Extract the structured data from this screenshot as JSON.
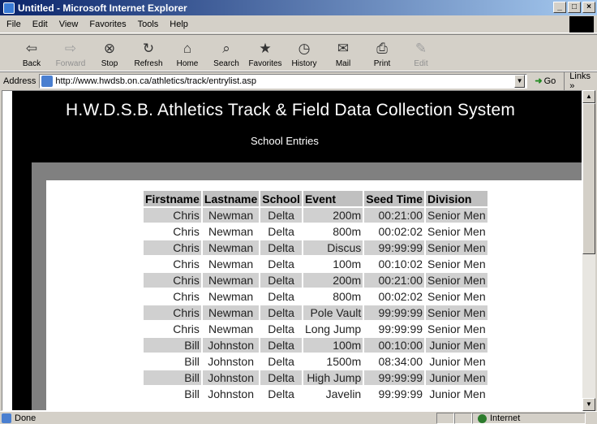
{
  "window": {
    "title": "Untitled - Microsoft Internet Explorer",
    "buttons": [
      "_",
      "□",
      "×"
    ]
  },
  "menu": [
    "File",
    "Edit",
    "View",
    "Favorites",
    "Tools",
    "Help"
  ],
  "toolbar": [
    {
      "label": "Back",
      "icon": "⇦",
      "disabled": false
    },
    {
      "label": "Forward",
      "icon": "⇨",
      "disabled": true
    },
    {
      "label": "Stop",
      "icon": "⊗",
      "disabled": false
    },
    {
      "label": "Refresh",
      "icon": "↻",
      "disabled": false
    },
    {
      "label": "Home",
      "icon": "⌂",
      "disabled": false
    },
    {
      "label": "Search",
      "icon": "⌕",
      "disabled": false
    },
    {
      "label": "Favorites",
      "icon": "★",
      "disabled": false
    },
    {
      "label": "History",
      "icon": "◷",
      "disabled": false
    },
    {
      "label": "Mail",
      "icon": "✉",
      "disabled": false
    },
    {
      "label": "Print",
      "icon": "⎙",
      "disabled": false
    },
    {
      "label": "Edit",
      "icon": "✎",
      "disabled": true
    }
  ],
  "address": {
    "label": "Address",
    "url": "http://www.hwdsb.on.ca/athletics/track/entrylist.asp",
    "go_label": "Go",
    "links_label": "Links »"
  },
  "page": {
    "title": "H.W.D.S.B. Athletics Track & Field Data Collection System",
    "subtitle": "School Entries"
  },
  "table": {
    "headers": [
      "Firstname",
      "Lastname",
      "School",
      "Event",
      "Seed Time",
      "Division"
    ],
    "rows": [
      [
        "Chris",
        "Newman",
        "Delta",
        "200m",
        "00:21:00",
        "Senior Men"
      ],
      [
        "Chris",
        "Newman",
        "Delta",
        "800m",
        "00:02:02",
        "Senior Men"
      ],
      [
        "Chris",
        "Newman",
        "Delta",
        "Discus",
        "99:99:99",
        "Senior Men"
      ],
      [
        "Chris",
        "Newman",
        "Delta",
        "100m",
        "00:10:02",
        "Senior Men"
      ],
      [
        "Chris",
        "Newman",
        "Delta",
        "200m",
        "00:21:00",
        "Senior Men"
      ],
      [
        "Chris",
        "Newman",
        "Delta",
        "800m",
        "00:02:02",
        "Senior Men"
      ],
      [
        "Chris",
        "Newman",
        "Delta",
        "Pole Vault",
        "99:99:99",
        "Senior Men"
      ],
      [
        "Chris",
        "Newman",
        "Delta",
        "Long Jump",
        "99:99:99",
        "Senior Men"
      ],
      [
        "Bill",
        "Johnston",
        "Delta",
        "100m",
        "00:10:00",
        "Junior Men"
      ],
      [
        "Bill",
        "Johnston",
        "Delta",
        "1500m",
        "08:34:00",
        "Junior Men"
      ],
      [
        "Bill",
        "Johnston",
        "Delta",
        "High Jump",
        "99:99:99",
        "Junior Men"
      ],
      [
        "Bill",
        "Johnston",
        "Delta",
        "Javelin",
        "99:99:99",
        "Junior Men"
      ]
    ]
  },
  "status": {
    "text": "Done",
    "zone": "Internet"
  }
}
